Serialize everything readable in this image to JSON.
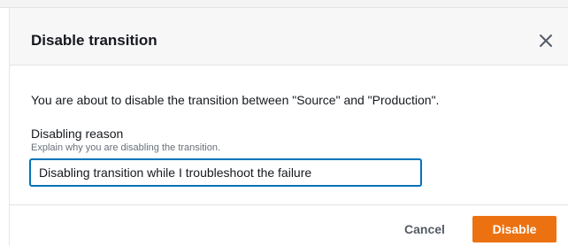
{
  "dialog": {
    "title": "Disable transition",
    "close_icon": "close-icon",
    "message": "You are about to disable the transition between \"Source\" and \"Production\".",
    "reason_field": {
      "label": "Disabling reason",
      "description": "Explain why you are disabling the transition.",
      "value": "Disabling transition while I troubleshoot the failure"
    },
    "buttons": {
      "cancel_label": "Cancel",
      "disable_label": "Disable"
    }
  },
  "colors": {
    "primary_button": "#ec7211",
    "input_focus": "#0073bb",
    "header_background": "#f7f7f7",
    "text": "#16191f",
    "description_text": "#687078"
  }
}
